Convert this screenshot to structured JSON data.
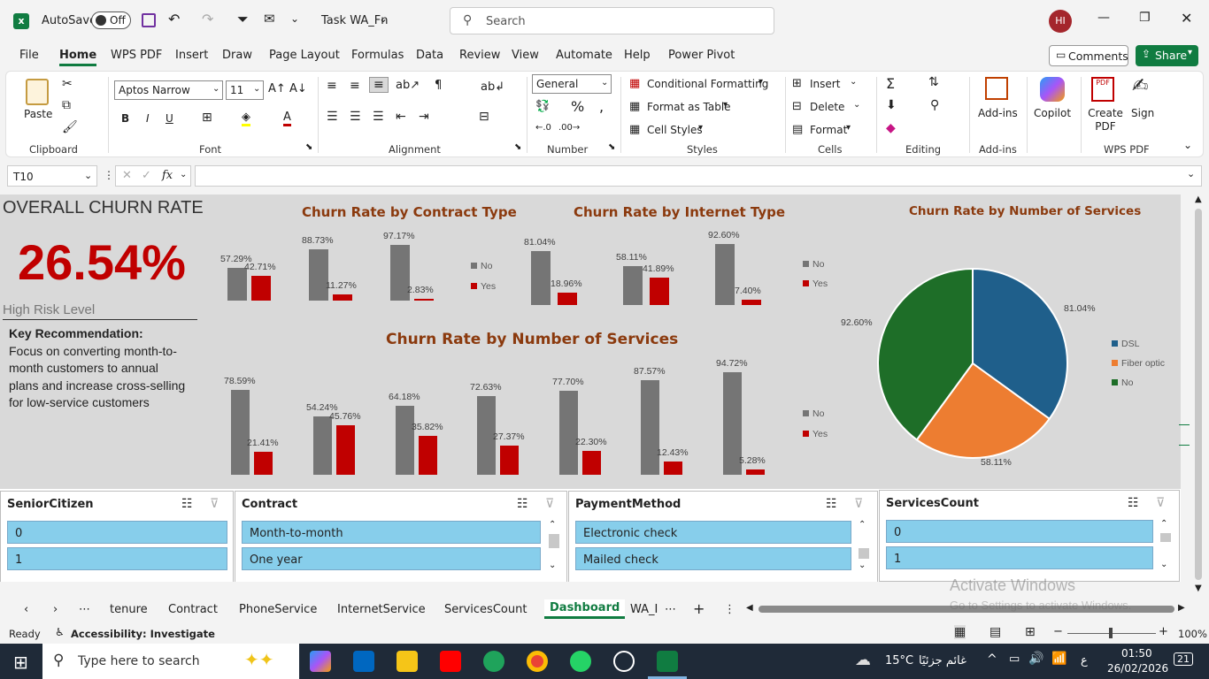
{
  "titlebar": {
    "autosave_label": "AutoSave",
    "toggle_state": "Off",
    "doc_title": "Task WA_Fn",
    "search_placeholder": "Search",
    "avatar": "HI"
  },
  "menu": [
    "File",
    "Home",
    "WPS PDF",
    "Insert",
    "Draw",
    "Page Layout",
    "Formulas",
    "Data",
    "Review",
    "View",
    "Automate",
    "Help",
    "Power Pivot"
  ],
  "menu_active": "Home",
  "comments_label": "Comments",
  "share_label": "Share",
  "ribbon": {
    "paste": "Paste",
    "clipboard": "Clipboard",
    "font_name": "Aptos Narrow",
    "font_size": "11",
    "font": "Font",
    "bold": "B",
    "italic": "I",
    "underline": "U",
    "alignment": "Alignment",
    "number_format": "General",
    "number": "Number",
    "cond_format": "Conditional Formatting",
    "format_table": "Format as Table",
    "cell_styles": "Cell Styles",
    "styles": "Styles",
    "insert": "Insert",
    "delete": "Delete",
    "format": "Format",
    "cells": "Cells",
    "editing": "Editing",
    "addins": "Add-ins",
    "addins_group": "Add-ins",
    "copilot": "Copilot",
    "create_pdf": "Create PDF",
    "sign": "Sign",
    "wps_pdf": "WPS PDF"
  },
  "formula_bar": {
    "cell_ref": "T10",
    "fx": "fx",
    "value": ""
  },
  "dashboard": {
    "overall_title": "OVERALL CHURN RATE",
    "overall_value": "26.54%",
    "risk_level": "High Risk Level",
    "rec_title": "Key Recommendation:",
    "rec_lines": [
      "Focus on converting month-to-",
      "month customers to annual",
      "plans and increase cross-selling",
      "for low-service customers"
    ]
  },
  "chart_data": [
    {
      "type": "bar",
      "title": "Churn Rate by Contract Type",
      "categories": [
        "",
        "",
        ""
      ],
      "series": [
        {
          "name": "No",
          "values": [
            57.29,
            88.73,
            97.17
          ]
        },
        {
          "name": "Yes",
          "values": [
            42.71,
            11.27,
            2.83
          ]
        }
      ],
      "labels_no": [
        "57.29%",
        "88.73%",
        "97.17%"
      ],
      "labels_yes": [
        "42.71%",
        "11.27%",
        "2.83%"
      ],
      "colors": [
        "#757575",
        "#c00000"
      ]
    },
    {
      "type": "bar",
      "title": "Churn Rate by Internet Type",
      "categories": [
        "",
        "",
        ""
      ],
      "series": [
        {
          "name": "No",
          "values": [
            81.04,
            58.11,
            92.6
          ]
        },
        {
          "name": "Yes",
          "values": [
            18.96,
            41.89,
            7.4
          ]
        }
      ],
      "labels_no": [
        "81.04%",
        "58.11%",
        "92.60%"
      ],
      "labels_yes": [
        "18.96%",
        "41.89%",
        "7.40%"
      ],
      "colors": [
        "#757575",
        "#c00000"
      ]
    },
    {
      "type": "bar",
      "title": "Churn Rate by Number of Services",
      "categories": [
        "",
        "",
        "",
        "",
        "",
        "",
        ""
      ],
      "series": [
        {
          "name": "No",
          "values": [
            78.59,
            54.24,
            64.18,
            72.63,
            77.7,
            87.57,
            94.72
          ]
        },
        {
          "name": "Yes",
          "values": [
            21.41,
            45.76,
            35.82,
            27.37,
            22.3,
            12.43,
            5.28
          ]
        }
      ],
      "labels_no": [
        "78.59%",
        "54.24%",
        "64.18%",
        "72.63%",
        "77.70%",
        "87.57%",
        "94.72%"
      ],
      "labels_yes": [
        "21.41%",
        "45.76%",
        "35.82%",
        "27.37%",
        "22.30%",
        "12.43%",
        "5.28%"
      ],
      "colors": [
        "#757575",
        "#c00000"
      ]
    },
    {
      "type": "pie",
      "title": "Churn Rate by Number of Services",
      "categories": [
        "DSL",
        "Fiber optic",
        "No"
      ],
      "values": [
        81.04,
        58.11,
        92.6
      ],
      "labels": [
        "81.04%",
        "58.11%",
        "92.60%"
      ],
      "colors": [
        "#1f5f8b",
        "#ed7d31",
        "#1e6e28"
      ]
    }
  ],
  "slicers": [
    {
      "title": "SeniorCitizen",
      "items": [
        "0",
        "1"
      ]
    },
    {
      "title": "Contract",
      "items": [
        "Month-to-month",
        "One year"
      ]
    },
    {
      "title": "PaymentMethod",
      "items": [
        "Electronic check",
        "Mailed check"
      ]
    },
    {
      "title": "ServicesCount",
      "items": [
        "0",
        "1"
      ]
    }
  ],
  "sheet_tabs": [
    "tenure",
    "Contract",
    "PhoneService",
    "InternetService",
    "ServicesCount",
    "Dashboard",
    "WA_I"
  ],
  "active_tab": "Dashboard",
  "status": {
    "ready": "Ready",
    "accessibility": "Accessibility: Investigate",
    "zoom": "100%"
  },
  "watermark": {
    "line1": "Activate Windows",
    "line2": "Go to Settings to activate Windows."
  },
  "taskbar": {
    "search_placeholder": "Type here to search",
    "weather": "15°C",
    "weather_text": "غائم جزئيًا",
    "lang": "ع",
    "time": "01:50",
    "date": "26/02/2026",
    "notif": "21"
  }
}
